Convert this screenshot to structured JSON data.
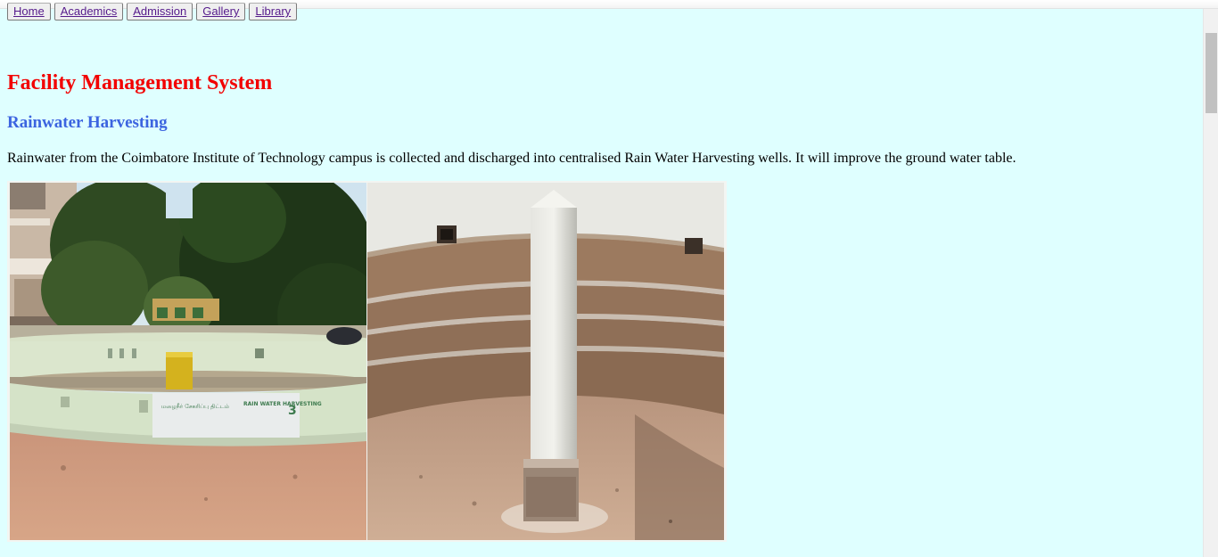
{
  "nav": {
    "items": [
      {
        "label": "Home"
      },
      {
        "label": "Academics"
      },
      {
        "label": "Admission"
      },
      {
        "label": "Gallery"
      },
      {
        "label": "Library"
      }
    ]
  },
  "page": {
    "title": "Facility Management System",
    "subtitle": "Rainwater Harvesting",
    "description": "Rainwater from the Coimbatore Institute of Technology campus is collected and discharged into centralised Rain Water Harvesting wells. It will improve the ground water table."
  },
  "photos": {
    "photo1": {
      "sign_tamil": "மழைநீர் சேகரிப்பு திட்டம்",
      "sign_english": "RAIN WATER HARVESTING",
      "sign_number": "3"
    }
  },
  "colors": {
    "background": "#dfffff",
    "title": "#f20000",
    "subtitle": "#3c64e0",
    "link": "#551a8b"
  }
}
